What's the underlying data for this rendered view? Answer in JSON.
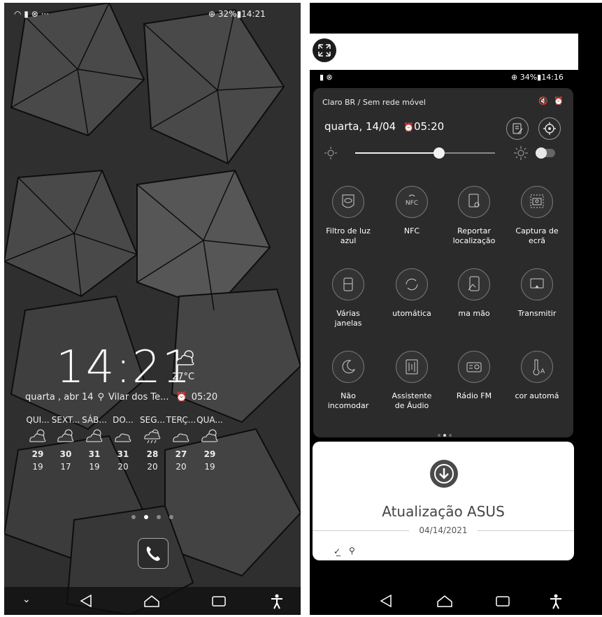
{
  "left_phone": {
    "status_time": "14:21",
    "status_battery": "32%",
    "clock": "14:21",
    "temperature": "27°C",
    "date": "quarta , abr 14",
    "location": "Vilar dos Te...",
    "alarm": "05:20",
    "forecast": [
      {
        "day": "QUI...",
        "high": "29",
        "low": "19",
        "icon": "partly-cloudy-icon"
      },
      {
        "day": "SEXT...",
        "high": "30",
        "low": "17",
        "icon": "partly-cloudy-icon"
      },
      {
        "day": "SÁB...",
        "high": "31",
        "low": "19",
        "icon": "partly-cloudy-icon"
      },
      {
        "day": "DO...",
        "high": "31",
        "low": "20",
        "icon": "cloud-icon"
      },
      {
        "day": "SEG...",
        "high": "28",
        "low": "20",
        "icon": "rain-cloud-icon"
      },
      {
        "day": "TERÇ...",
        "high": "27",
        "low": "20",
        "icon": "cloud-icon"
      },
      {
        "day": "QUA...",
        "high": "29",
        "low": "19",
        "icon": "partly-cloudy-icon"
      }
    ]
  },
  "right_phone": {
    "status_time": "14:16",
    "status_battery": "34%",
    "carrier": "Claro BR / Sem rede móvel",
    "date": "quarta, 14/04",
    "alarm": "05:20",
    "brightness_level": 0.6,
    "tiles": [
      {
        "label1": "Filtro de luz",
        "label2": "azul",
        "icon": "eye-shield-icon"
      },
      {
        "label1": "NFC",
        "label2": "",
        "icon": "nfc-icon"
      },
      {
        "label1": "Reportar",
        "label2": "localização",
        "icon": "report-location-icon"
      },
      {
        "label1": "Captura de",
        "label2": "ecrã",
        "icon": "screenshot-icon"
      },
      {
        "label1": "Várias",
        "label2": "janelas",
        "icon": "multi-window-icon"
      },
      {
        "label1": "utomática",
        "label2": "",
        "icon": "auto-rotate-icon"
      },
      {
        "label1": "ma mão",
        "label2": "",
        "icon": "one-hand-icon"
      },
      {
        "label1": "Transmitir",
        "label2": "",
        "icon": "cast-icon"
      },
      {
        "label1": "Não",
        "label2": "incomodar",
        "icon": "moon-icon"
      },
      {
        "label1": "Assistente",
        "label2": "de Áudio",
        "icon": "audio-wizard-icon"
      },
      {
        "label1": "Rádio FM",
        "label2": "",
        "icon": "radio-icon"
      },
      {
        "label1": "cor automá",
        "label2": "",
        "icon": "auto-color-icon"
      }
    ],
    "notification": {
      "title": "Atualização ASUS",
      "date": "04/14/2021"
    }
  }
}
